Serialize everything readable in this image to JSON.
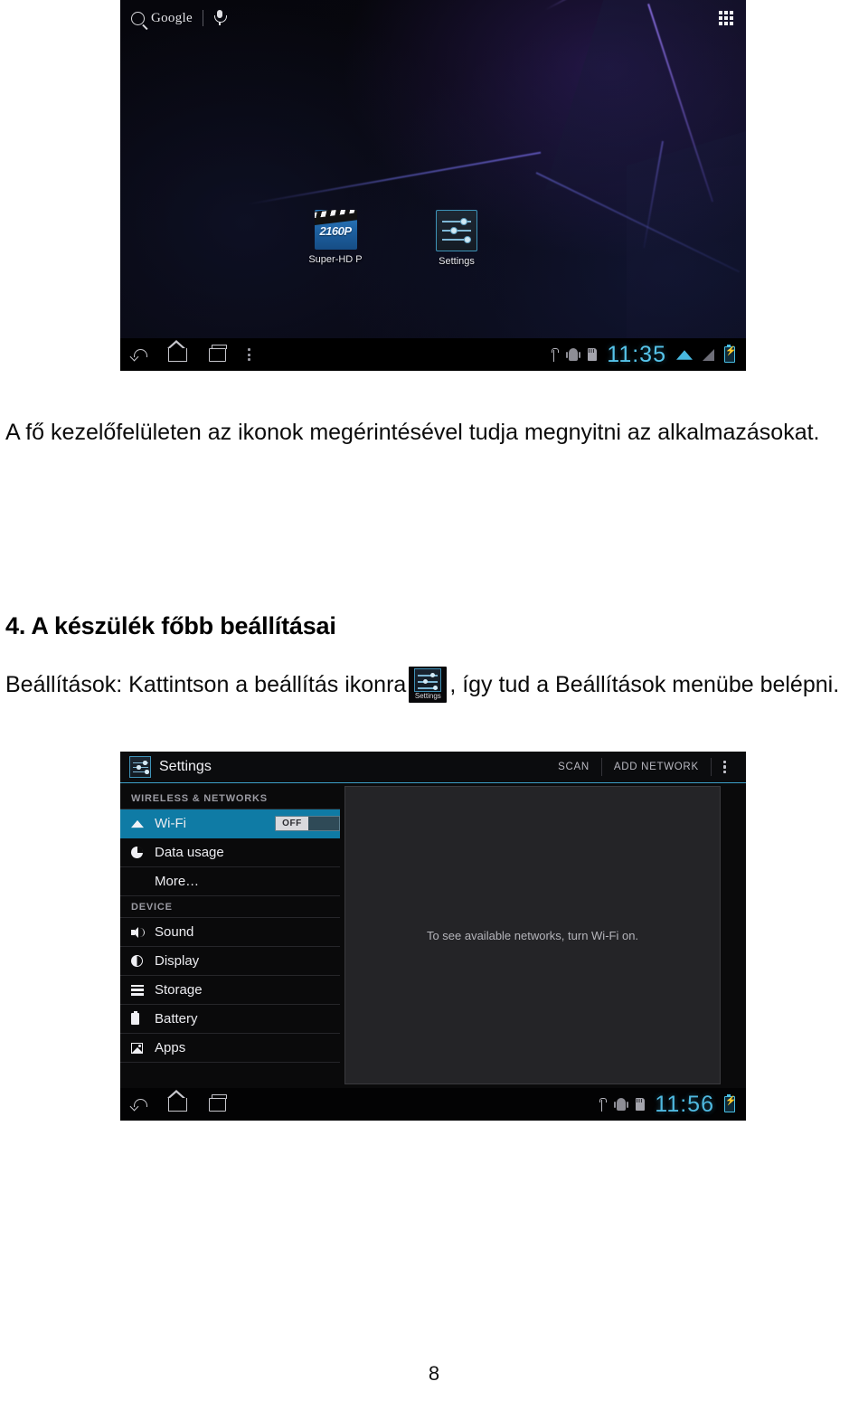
{
  "document": {
    "page_number": "8"
  },
  "home_screenshot": {
    "search": {
      "brand": "Google",
      "search_icon": "search-icon",
      "mic_icon": "microphone-icon"
    },
    "apps_button_icon": "apps-grid-icon",
    "apps": [
      {
        "label": "Super-HD P",
        "badge": "2160P",
        "icon": "video-player-icon"
      },
      {
        "label": "Settings",
        "icon": "settings-icon"
      }
    ],
    "navbar": {
      "back_icon": "back-icon",
      "home_icon": "home-icon",
      "recents_icon": "recent-apps-icon",
      "menu_icon": "overflow-menu-icon",
      "usb_icon": "usb-icon",
      "android_icon": "android-debug-icon",
      "sdcard_icon": "sd-card-icon",
      "time": "11:35",
      "wifi_icon": "wifi-icon",
      "signal_icon": "signal-icon",
      "battery_icon": "battery-charging-icon"
    }
  },
  "body": {
    "paragraph1": "A fő kezelőfelületen az ikonok megérintésével tudja megnyitni az alkalmazásokat.",
    "section_heading": "4. A készülék főbb beállításai",
    "paragraph2_before": "Beállítások: Kattintson a beállítás ikonra",
    "paragraph2_after": ", így tud a Beállítások menübe belépni.",
    "inline_icon_label": "Settings"
  },
  "settings_screenshot": {
    "actionbar": {
      "icon": "settings-icon",
      "title": "Settings",
      "scan_label": "SCAN",
      "add_network_label": "ADD NETWORK",
      "overflow_icon": "overflow-menu-icon"
    },
    "groups": [
      {
        "header": "WIRELESS & NETWORKS",
        "rows": [
          {
            "label": "Wi-Fi",
            "icon": "wifi-icon",
            "selected": true,
            "toggle": "OFF"
          },
          {
            "label": "Data usage",
            "icon": "data-usage-icon",
            "selected": false
          },
          {
            "label": "More…",
            "icon": "",
            "selected": false
          }
        ]
      },
      {
        "header": "DEVICE",
        "rows": [
          {
            "label": "Sound",
            "icon": "sound-icon",
            "selected": false
          },
          {
            "label": "Display",
            "icon": "display-icon",
            "selected": false
          },
          {
            "label": "Storage",
            "icon": "storage-icon",
            "selected": false
          },
          {
            "label": "Battery",
            "icon": "battery-icon",
            "selected": false
          },
          {
            "label": "Apps",
            "icon": "apps-icon",
            "selected": false
          }
        ]
      }
    ],
    "detail_message": "To see available networks, turn Wi-Fi on.",
    "navbar": {
      "back_icon": "back-icon",
      "home_icon": "home-icon",
      "recents_icon": "recent-apps-icon",
      "usb_icon": "usb-icon",
      "android_icon": "android-debug-icon",
      "sdcard_icon": "sd-card-icon",
      "time": "11:56",
      "battery_icon": "battery-charging-icon"
    },
    "accent_color": "#0f7ba5"
  }
}
